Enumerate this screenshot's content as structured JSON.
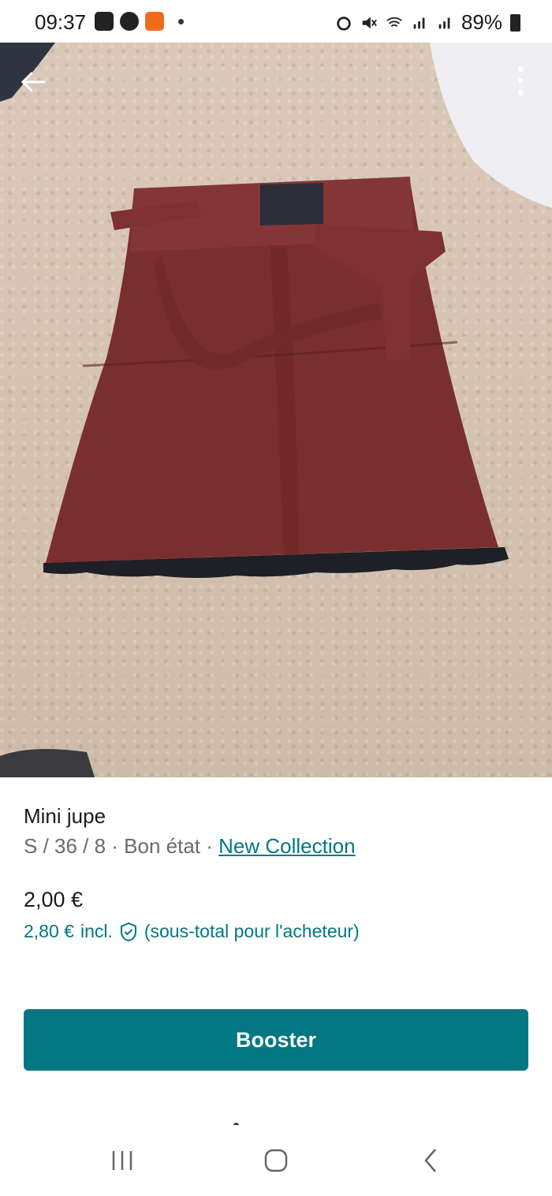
{
  "status_bar": {
    "time": "09:37",
    "battery": "89%",
    "icons_left": [
      "gallery-icon",
      "messenger-icon",
      "app-notification-icon"
    ],
    "icons_right": [
      "alarm-icon",
      "mute-icon",
      "wifi-icon",
      "signal-icon",
      "signal-icon",
      "battery-icon"
    ]
  },
  "listing": {
    "title": "Mini jupe",
    "meta_prefix": "S / 36 / 8 · Bon état · ",
    "brand_link": "New Collection",
    "price": "2,00 €",
    "buyer_price": "2,80 €",
    "buyer_incl": "incl.",
    "buyer_note": "(sous-total pour l'acheteur)"
  },
  "actions": {
    "booster_label": "Booster"
  },
  "colors": {
    "accent": "#007782",
    "skirt": "#7a2f2f"
  }
}
